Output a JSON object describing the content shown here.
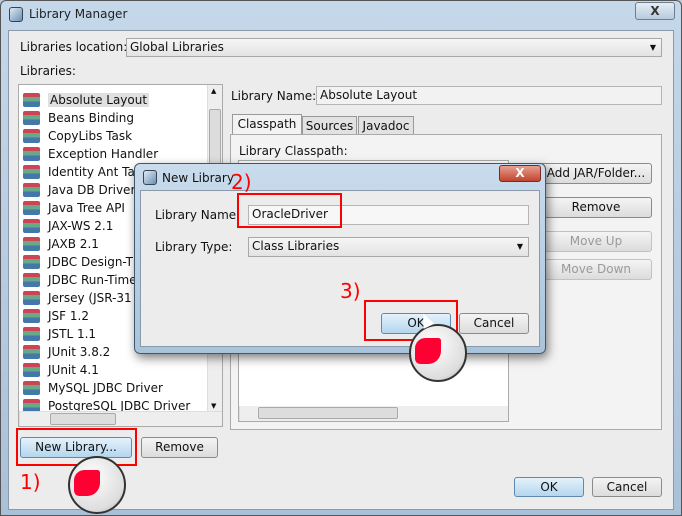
{
  "window": {
    "title": "Library Manager",
    "close": "X"
  },
  "location": {
    "label": "Libraries location:",
    "value": "Global Libraries"
  },
  "libraries": {
    "label": "Libraries:",
    "items": [
      "Absolute Layout",
      "Beans Binding",
      "CopyLibs Task",
      "Exception Handler",
      "Identity Ant Tas",
      "Java DB Driver",
      "Java Tree API",
      "JAX-WS 2.1",
      "JAXB 2.1",
      "JDBC Design-T",
      "JDBC Run-Time",
      "Jersey (JSR-31",
      "JSF 1.2",
      "JSTL 1.1",
      "JUnit 3.8.2",
      "JUnit 4.1",
      "MySQL JDBC Driver",
      "PostgreSQL JDBC Driver"
    ],
    "selected": "Absolute Layout",
    "new_library": "New Library...",
    "remove": "Remove"
  },
  "details": {
    "name_label": "Library Name:",
    "name_value": "Absolute Layout",
    "tabs": [
      "Classpath",
      "Sources",
      "Javadoc"
    ],
    "active_tab": "Classpath",
    "classpath_label": "Library Classpath:",
    "add_jar": "Add JAR/Folder...",
    "remove": "Remove",
    "move_up": "Move Up",
    "move_down": "Move Down"
  },
  "footer": {
    "ok": "OK",
    "cancel": "Cancel"
  },
  "dialog": {
    "title": "New Library",
    "close": "X",
    "name_label": "Library Name:",
    "name_value": "OracleDriver",
    "type_label": "Library Type:",
    "type_value": "Class Libraries",
    "ok": "OK",
    "cancel": "Cancel"
  },
  "annotations": {
    "step1": "1)",
    "step2": "2)",
    "step3": "3)",
    "color": "#ff0000"
  }
}
